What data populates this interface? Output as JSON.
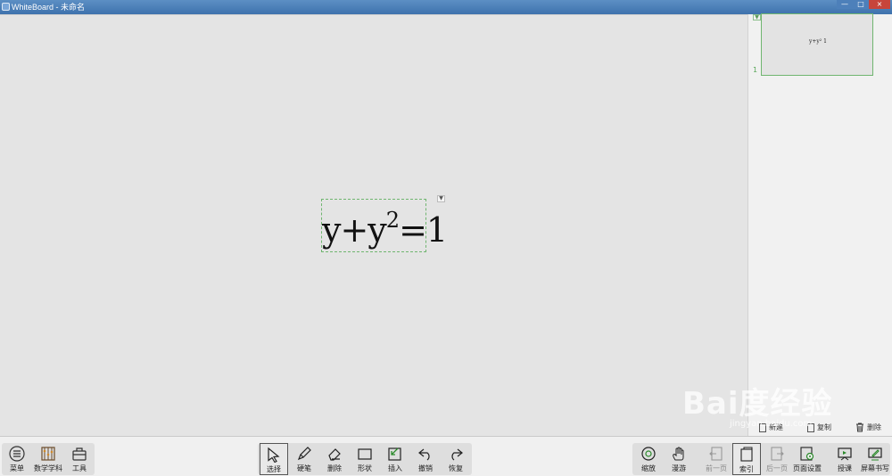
{
  "window": {
    "title": "WhiteBoard - 未命名",
    "controls": {
      "minimize": "—",
      "maximize": "□",
      "close": "×"
    }
  },
  "canvas": {
    "formula": {
      "base": "y+y",
      "exponent": "2",
      "rest": "=1"
    },
    "formula_menu_icon": "chevron-down-icon"
  },
  "side_panel": {
    "collapse_icon": "chevron-down-icon",
    "page_number": "1",
    "thumbnail_text": "y+y² 1",
    "actions": [
      {
        "label": "新建",
        "icon": "new-page-icon"
      },
      {
        "label": "复制",
        "icon": "copy-page-icon"
      },
      {
        "label": "删除",
        "icon": "trash-icon"
      }
    ]
  },
  "toolbar": {
    "left": [
      {
        "label": "菜单",
        "icon": "menu-icon"
      },
      {
        "label": "数学学科",
        "icon": "abacus-icon"
      },
      {
        "label": "工具",
        "icon": "toolbox-icon"
      }
    ],
    "center": [
      {
        "label": "选择",
        "icon": "cursor-icon",
        "active": true
      },
      {
        "label": "硬笔",
        "icon": "pen-icon"
      },
      {
        "label": "删除",
        "icon": "eraser-icon"
      },
      {
        "label": "形状",
        "icon": "rectangle-icon"
      },
      {
        "label": "插入",
        "icon": "insert-icon"
      },
      {
        "label": "撤销",
        "icon": "undo-icon"
      },
      {
        "label": "恢复",
        "icon": "redo-icon"
      }
    ],
    "right": [
      {
        "label": "缩放",
        "icon": "zoom-icon"
      },
      {
        "label": "漫游",
        "icon": "hand-icon"
      },
      {
        "label": "前一页",
        "icon": "prev-page-icon",
        "disabled": true
      },
      {
        "label": "索引",
        "icon": "index-icon",
        "active": true
      },
      {
        "label": "后一页",
        "icon": "next-page-icon",
        "disabled": true
      },
      {
        "label": "页面设置",
        "icon": "page-settings-icon"
      },
      {
        "label": "授课",
        "icon": "present-icon"
      },
      {
        "label": "屏幕书写",
        "icon": "screen-write-icon"
      }
    ]
  },
  "watermark": {
    "main": "Bai度经验",
    "sub": "jingyan.baidu.com"
  },
  "colors": {
    "accent_green": "#6fb56f",
    "titlebar": "#3e72ad",
    "close_red": "#c7453b"
  }
}
